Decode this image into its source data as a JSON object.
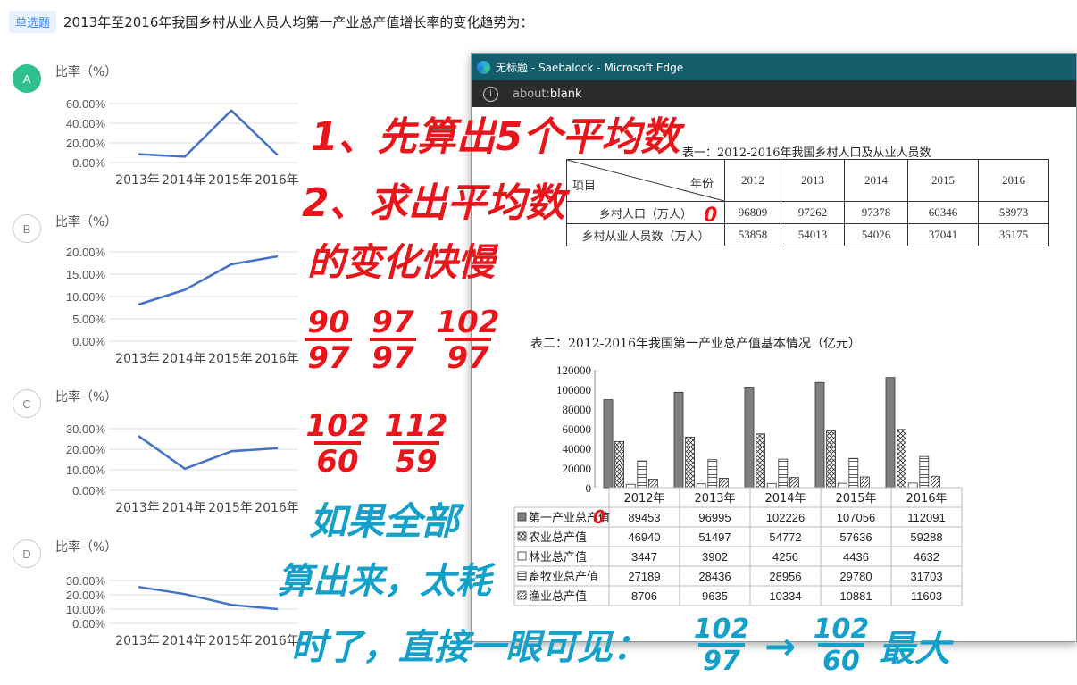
{
  "question": {
    "tag": "单选题",
    "text": "2013年至2016年我国乡村从业人员人均第一产业总产值增长率的变化趋势为："
  },
  "options": [
    {
      "letter": "A",
      "selected": true,
      "ylabel": "比率（%）",
      "yticks": [
        "60.00%",
        "40.00%",
        "20.00%",
        "0.00%"
      ],
      "ymax": 60,
      "categories": [
        "2013年",
        "2014年",
        "2015年",
        "2016年"
      ],
      "values": [
        8.5,
        6,
        53,
        7.5
      ]
    },
    {
      "letter": "B",
      "selected": false,
      "ylabel": "比率（%）",
      "yticks": [
        "20.00%",
        "15.00%",
        "10.00%",
        "5.00%",
        "0.00%"
      ],
      "ymax": 20,
      "categories": [
        "2013年",
        "2014年",
        "2015年",
        "2016年"
      ],
      "values": [
        8.2,
        11.5,
        17.2,
        19
      ]
    },
    {
      "letter": "C",
      "selected": false,
      "ylabel": "比率（%）",
      "yticks": [
        "30.00%",
        "20.00%",
        "10.00%",
        "0.00%"
      ],
      "ymax": 30,
      "categories": [
        "2013年",
        "2014年",
        "2015年",
        "2016年"
      ],
      "values": [
        26.5,
        10.5,
        19,
        20.5
      ]
    },
    {
      "letter": "D",
      "selected": false,
      "ylabel": "比率（%）",
      "yticks": [
        "30.00%",
        "20.00%",
        "10.00%",
        "0.00%"
      ],
      "ymax": 30,
      "categories": [
        "2013年",
        "2014年",
        "2015年",
        "2016年"
      ],
      "values": [
        25.5,
        20.5,
        13,
        10
      ]
    }
  ],
  "window": {
    "title": "无标题 - Saebalock - Microsoft Edge",
    "address_prefix": "about:",
    "address_main": "blank",
    "info_glyph": "i"
  },
  "table1": {
    "title": "表一：2012-2016年我国乡村人口及从业人员数",
    "corner_left": "项目",
    "corner_right": "年份",
    "years": [
      "2012",
      "2013",
      "2014",
      "2015",
      "2016"
    ],
    "rows": [
      {
        "label": "乡村人口（万人）",
        "values": [
          "96809",
          "97262",
          "97378",
          "60346",
          "58973"
        ]
      },
      {
        "label": "乡村从业人员数（万人）",
        "values": [
          "53858",
          "54013",
          "54026",
          "37041",
          "36175"
        ]
      }
    ]
  },
  "table2": {
    "title": "表二：2012-2016年我国第一产业总产值基本情况（亿元）"
  },
  "chart_data": [
    {
      "type": "bar",
      "title": "表二：2012-2016年我国第一产业总产值基本情况（亿元）",
      "categories": [
        "2012年",
        "2013年",
        "2014年",
        "2015年",
        "2016年"
      ],
      "yticks": [
        "120000",
        "100000",
        "80000",
        "60000",
        "40000",
        "20000",
        "0"
      ],
      "ylim": [
        0,
        120000
      ],
      "series": [
        {
          "name": "第一产业总产值",
          "pattern": "solid",
          "values": [
            89453,
            96995,
            102226,
            107056,
            112091
          ]
        },
        {
          "name": "农业总产值",
          "pattern": "cross",
          "values": [
            46940,
            51497,
            54772,
            57636,
            59288
          ]
        },
        {
          "name": "林业总产值",
          "pattern": "empty",
          "values": [
            3447,
            3902,
            4256,
            4436,
            4632
          ]
        },
        {
          "name": "畜牧业总产值",
          "pattern": "hlines",
          "values": [
            27189,
            28436,
            28956,
            29780,
            31703
          ]
        },
        {
          "name": "渔业总产值",
          "pattern": "diag",
          "values": [
            8706,
            9635,
            10334,
            10881,
            11603
          ]
        }
      ]
    },
    {
      "type": "line",
      "categories": [
        "2013年",
        "2014年",
        "2015年",
        "2016年"
      ],
      "series": [
        {
          "values": [
            8.5,
            6,
            53,
            7.5
          ]
        }
      ],
      "ylim": [
        0,
        60
      ]
    },
    {
      "type": "line",
      "categories": [
        "2013年",
        "2014年",
        "2015年",
        "2016年"
      ],
      "series": [
        {
          "values": [
            8.2,
            11.5,
            17.2,
            19
          ]
        }
      ],
      "ylim": [
        0,
        20
      ]
    },
    {
      "type": "line",
      "categories": [
        "2013年",
        "2014年",
        "2015年",
        "2016年"
      ],
      "series": [
        {
          "values": [
            26.5,
            10.5,
            19,
            20.5
          ]
        }
      ],
      "ylim": [
        0,
        30
      ]
    },
    {
      "type": "line",
      "categories": [
        "2013年",
        "2014年",
        "2015年",
        "2016年"
      ],
      "series": [
        {
          "values": [
            25.5,
            20.5,
            13,
            10
          ]
        }
      ],
      "ylim": [
        0,
        30
      ]
    }
  ],
  "annotations": {
    "red_lines": [
      "1、先算出5个平均数",
      "2、求出平均数",
      "的变化快慢"
    ],
    "red_fracs": [
      [
        "90",
        "97"
      ],
      [
        "97",
        "97"
      ],
      [
        "102",
        "97"
      ],
      [
        "102",
        "60"
      ],
      [
        "112",
        "59"
      ]
    ],
    "red_circle_mark": "0",
    "blue_lines": [
      "如果全部",
      "算出来，太耗",
      "时了，直接一眼可见："
    ],
    "blue_fracs": [
      [
        "102",
        "97"
      ],
      [
        "102",
        "60"
      ]
    ],
    "blue_arrow": "→",
    "blue_end": "最大",
    "colors": {
      "red": "#e8161b",
      "blue": "#14a0c8",
      "line": "#4472c4",
      "titlebar": "#145e6b"
    }
  }
}
